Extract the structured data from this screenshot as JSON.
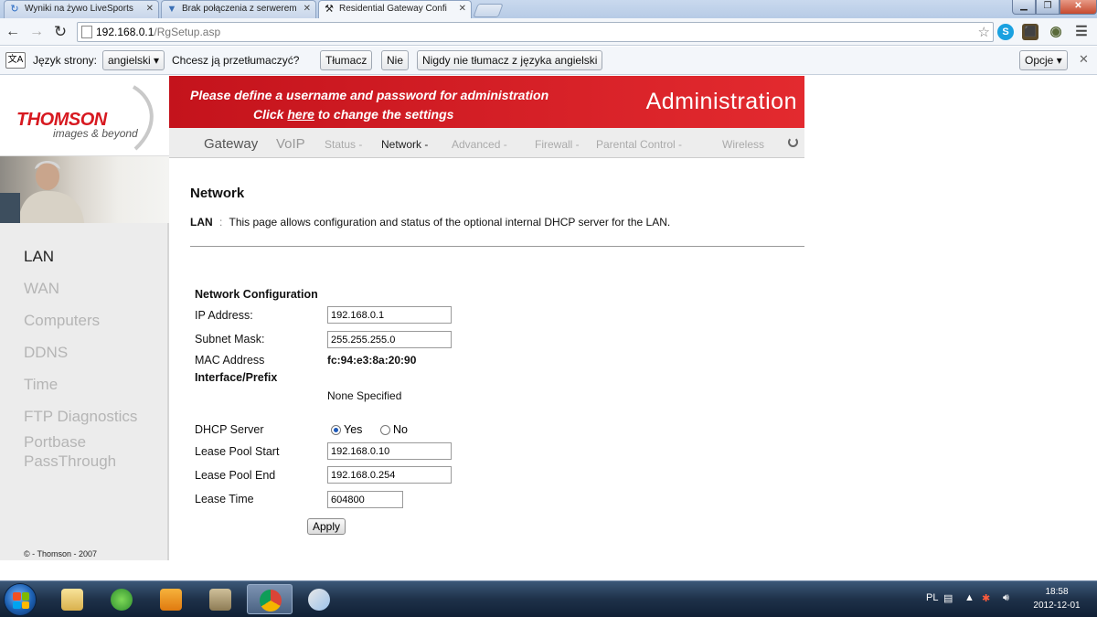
{
  "browser": {
    "tabs": [
      {
        "title": "Wyniki na żywo LiveSports"
      },
      {
        "title": "Brak połączenia z serwerem"
      },
      {
        "title": "Residential Gateway Confi"
      }
    ],
    "url_host": "192.168.0.1",
    "url_path": "/RgSetup.asp"
  },
  "translate_bar": {
    "page_language_label": "Język strony:",
    "language_value": "angielski",
    "question": "Chcesz ją przetłumaczyć?",
    "translate_button": "Tłumacz",
    "no_button": "Nie",
    "never_button": "Nigdy nie tłumacz z języka angielski",
    "options_button": "Opcje"
  },
  "header": {
    "logo": "THOMSON",
    "tagline": "images & beyond",
    "banner_line1": "Please define a username and password for administration",
    "banner_click": "Click",
    "banner_link": "here",
    "banner_rest": "to change the settings",
    "title": "Administration"
  },
  "topnav": {
    "gateway": "Gateway",
    "voip": "VoIP",
    "status": "Status -",
    "network": "Network -",
    "advanced": "Advanced -",
    "firewall": "Firewall -",
    "parental": "Parental Control -",
    "wireless": "Wireless"
  },
  "sidebar": {
    "items": [
      {
        "label": "LAN"
      },
      {
        "label": "WAN"
      },
      {
        "label": "Computers"
      },
      {
        "label": "DDNS"
      },
      {
        "label": "Time"
      },
      {
        "label": "FTP Diagnostics"
      },
      {
        "label": "Portbase"
      },
      {
        "label": "PassThrough"
      }
    ],
    "copyright": "© - Thomson - 2007"
  },
  "main": {
    "title": "Network",
    "desc_label": "LAN",
    "desc_sep": ":",
    "description": "This page allows configuration and status of the optional internal DHCP server for the LAN.",
    "section": "Network Configuration",
    "ip_label": "IP Address:",
    "ip_value": "192.168.0.1",
    "mask_label": "Subnet Mask:",
    "mask_value": "255.255.255.0",
    "mac_label": "MAC Address",
    "mac_value": "fc:94:e3:8a:20:90",
    "iface_label": "Interface/Prefix",
    "iface_value": "None Specified",
    "dhcp_label": "DHCP Server",
    "dhcp_yes": "Yes",
    "dhcp_no": "No",
    "pool_start_label": "Lease Pool Start",
    "pool_start_value": "192.168.0.10",
    "pool_end_label": "Lease Pool End",
    "pool_end_value": "192.168.0.254",
    "lease_time_label": "Lease Time",
    "lease_time_value": "604800",
    "apply": "Apply"
  },
  "taskbar": {
    "lang": "PL",
    "time": "18:58",
    "date": "2012-12-01"
  }
}
